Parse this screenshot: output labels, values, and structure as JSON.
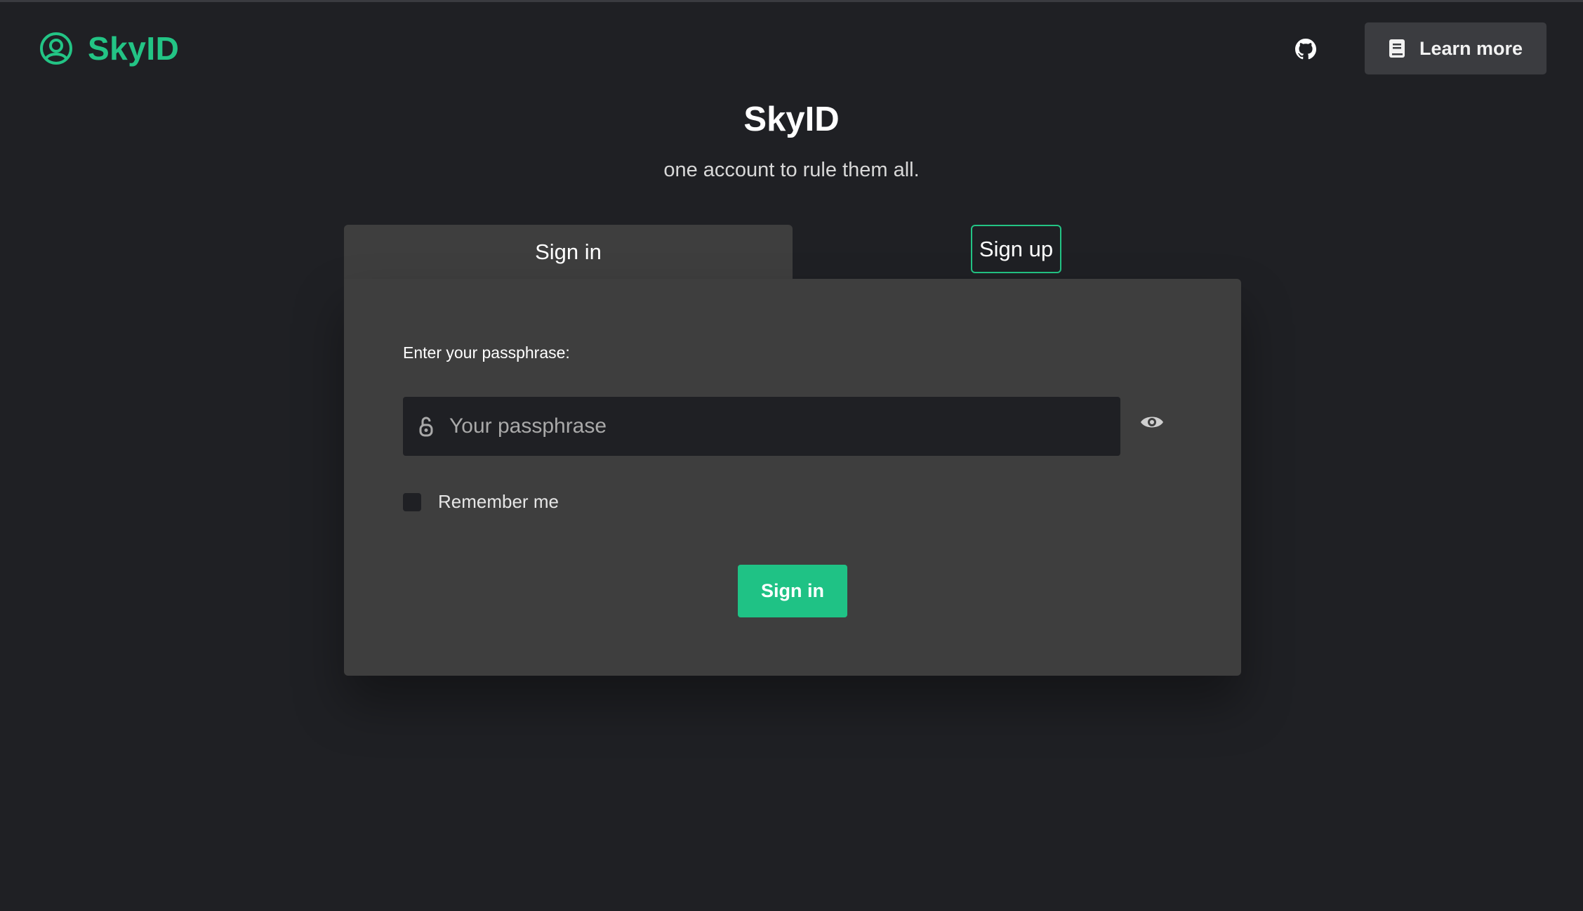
{
  "colors": {
    "background": "#1f2024",
    "card": "#3e3e3e",
    "accent": "#23c485",
    "primary_button": "#1fc285"
  },
  "header": {
    "brand_name": "SkyID",
    "brand_icon": "user-circle-icon",
    "github_icon": "github-icon",
    "learn_more_icon": "book-icon",
    "learn_more_label": "Learn more"
  },
  "hero": {
    "title": "SkyID",
    "subtitle": "one account to rule them all."
  },
  "tabs": {
    "signin_label": "Sign in",
    "signup_label": "Sign up",
    "active": "Sign in"
  },
  "form": {
    "passphrase_label": "Enter your passphrase:",
    "passphrase_placeholder": "Your passphrase",
    "passphrase_value": "",
    "lock_icon": "unlock-icon",
    "toggle_visibility_icon": "eye-icon",
    "remember_label": "Remember me",
    "remember_checked": false,
    "submit_label": "Sign in"
  }
}
